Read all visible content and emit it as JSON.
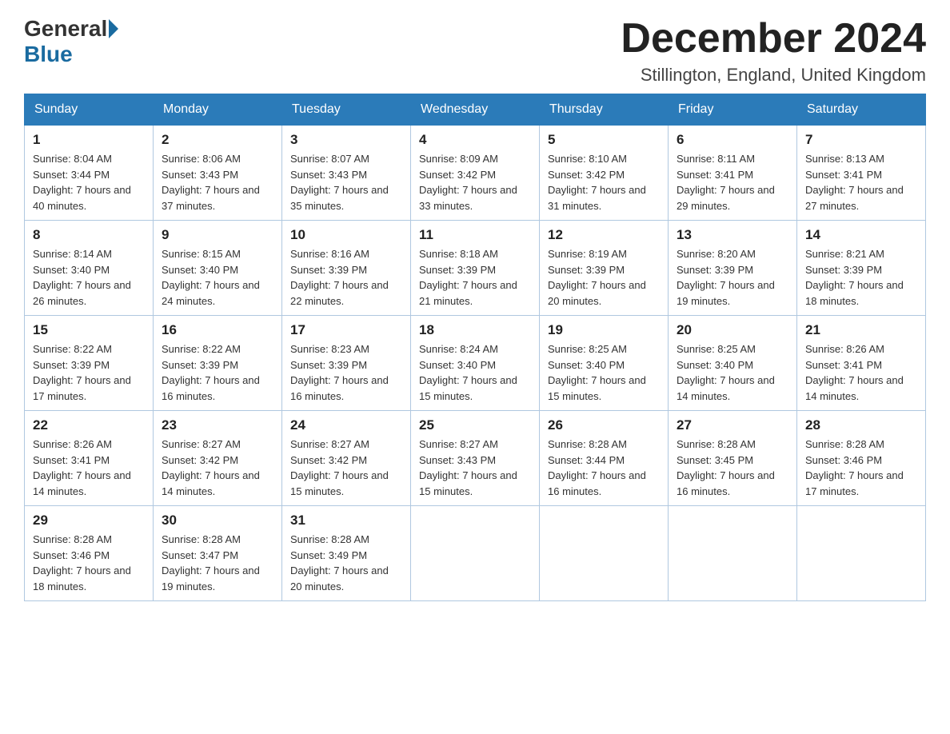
{
  "logo": {
    "general": "General",
    "blue": "Blue"
  },
  "title": "December 2024",
  "subtitle": "Stillington, England, United Kingdom",
  "days_of_week": [
    "Sunday",
    "Monday",
    "Tuesday",
    "Wednesday",
    "Thursday",
    "Friday",
    "Saturday"
  ],
  "weeks": [
    [
      {
        "num": "1",
        "sunrise": "8:04 AM",
        "sunset": "3:44 PM",
        "daylight": "7 hours and 40 minutes."
      },
      {
        "num": "2",
        "sunrise": "8:06 AM",
        "sunset": "3:43 PM",
        "daylight": "7 hours and 37 minutes."
      },
      {
        "num": "3",
        "sunrise": "8:07 AM",
        "sunset": "3:43 PM",
        "daylight": "7 hours and 35 minutes."
      },
      {
        "num": "4",
        "sunrise": "8:09 AM",
        "sunset": "3:42 PM",
        "daylight": "7 hours and 33 minutes."
      },
      {
        "num": "5",
        "sunrise": "8:10 AM",
        "sunset": "3:42 PM",
        "daylight": "7 hours and 31 minutes."
      },
      {
        "num": "6",
        "sunrise": "8:11 AM",
        "sunset": "3:41 PM",
        "daylight": "7 hours and 29 minutes."
      },
      {
        "num": "7",
        "sunrise": "8:13 AM",
        "sunset": "3:41 PM",
        "daylight": "7 hours and 27 minutes."
      }
    ],
    [
      {
        "num": "8",
        "sunrise": "8:14 AM",
        "sunset": "3:40 PM",
        "daylight": "7 hours and 26 minutes."
      },
      {
        "num": "9",
        "sunrise": "8:15 AM",
        "sunset": "3:40 PM",
        "daylight": "7 hours and 24 minutes."
      },
      {
        "num": "10",
        "sunrise": "8:16 AM",
        "sunset": "3:39 PM",
        "daylight": "7 hours and 22 minutes."
      },
      {
        "num": "11",
        "sunrise": "8:18 AM",
        "sunset": "3:39 PM",
        "daylight": "7 hours and 21 minutes."
      },
      {
        "num": "12",
        "sunrise": "8:19 AM",
        "sunset": "3:39 PM",
        "daylight": "7 hours and 20 minutes."
      },
      {
        "num": "13",
        "sunrise": "8:20 AM",
        "sunset": "3:39 PM",
        "daylight": "7 hours and 19 minutes."
      },
      {
        "num": "14",
        "sunrise": "8:21 AM",
        "sunset": "3:39 PM",
        "daylight": "7 hours and 18 minutes."
      }
    ],
    [
      {
        "num": "15",
        "sunrise": "8:22 AM",
        "sunset": "3:39 PM",
        "daylight": "7 hours and 17 minutes."
      },
      {
        "num": "16",
        "sunrise": "8:22 AM",
        "sunset": "3:39 PM",
        "daylight": "7 hours and 16 minutes."
      },
      {
        "num": "17",
        "sunrise": "8:23 AM",
        "sunset": "3:39 PM",
        "daylight": "7 hours and 16 minutes."
      },
      {
        "num": "18",
        "sunrise": "8:24 AM",
        "sunset": "3:40 PM",
        "daylight": "7 hours and 15 minutes."
      },
      {
        "num": "19",
        "sunrise": "8:25 AM",
        "sunset": "3:40 PM",
        "daylight": "7 hours and 15 minutes."
      },
      {
        "num": "20",
        "sunrise": "8:25 AM",
        "sunset": "3:40 PM",
        "daylight": "7 hours and 14 minutes."
      },
      {
        "num": "21",
        "sunrise": "8:26 AM",
        "sunset": "3:41 PM",
        "daylight": "7 hours and 14 minutes."
      }
    ],
    [
      {
        "num": "22",
        "sunrise": "8:26 AM",
        "sunset": "3:41 PM",
        "daylight": "7 hours and 14 minutes."
      },
      {
        "num": "23",
        "sunrise": "8:27 AM",
        "sunset": "3:42 PM",
        "daylight": "7 hours and 14 minutes."
      },
      {
        "num": "24",
        "sunrise": "8:27 AM",
        "sunset": "3:42 PM",
        "daylight": "7 hours and 15 minutes."
      },
      {
        "num": "25",
        "sunrise": "8:27 AM",
        "sunset": "3:43 PM",
        "daylight": "7 hours and 15 minutes."
      },
      {
        "num": "26",
        "sunrise": "8:28 AM",
        "sunset": "3:44 PM",
        "daylight": "7 hours and 16 minutes."
      },
      {
        "num": "27",
        "sunrise": "8:28 AM",
        "sunset": "3:45 PM",
        "daylight": "7 hours and 16 minutes."
      },
      {
        "num": "28",
        "sunrise": "8:28 AM",
        "sunset": "3:46 PM",
        "daylight": "7 hours and 17 minutes."
      }
    ],
    [
      {
        "num": "29",
        "sunrise": "8:28 AM",
        "sunset": "3:46 PM",
        "daylight": "7 hours and 18 minutes."
      },
      {
        "num": "30",
        "sunrise": "8:28 AM",
        "sunset": "3:47 PM",
        "daylight": "7 hours and 19 minutes."
      },
      {
        "num": "31",
        "sunrise": "8:28 AM",
        "sunset": "3:49 PM",
        "daylight": "7 hours and 20 minutes."
      },
      null,
      null,
      null,
      null
    ]
  ],
  "labels": {
    "sunrise": "Sunrise: ",
    "sunset": "Sunset: ",
    "daylight": "Daylight: "
  }
}
